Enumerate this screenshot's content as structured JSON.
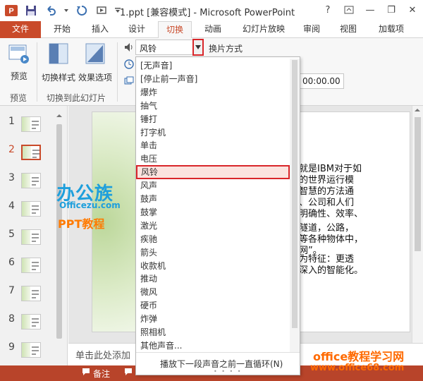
{
  "window": {
    "title": "1.ppt [兼容模式] - Microsoft PowerPoint",
    "controls": [
      "?",
      "—",
      "❐",
      "✕"
    ]
  },
  "tabs": [
    {
      "label": "文件",
      "type": "file"
    },
    {
      "label": "开始"
    },
    {
      "label": "插入"
    },
    {
      "label": "设计"
    },
    {
      "label": "切换",
      "active": true
    },
    {
      "label": "动画"
    },
    {
      "label": "幻灯片放映"
    },
    {
      "label": "审阅"
    },
    {
      "label": "视图"
    },
    {
      "label": "加载项"
    }
  ],
  "ribbon": {
    "preview_label": "预览",
    "transition_style_label": "切换样式",
    "effect_options_label": "效果选项",
    "group_preview": "预览",
    "group_transition_to_slide": "切换到此幻灯片",
    "sound_value": "风铃",
    "switch_mode_label": "换片方式",
    "duration_value": "00:00.00"
  },
  "dropdown": {
    "items": [
      "[无声音]",
      "[停止前一声音]",
      "爆炸",
      "抽气",
      "锤打",
      "打字机",
      "单击",
      "电压",
      "风铃",
      "风声",
      "鼓声",
      "鼓掌",
      "激光",
      "疾驰",
      "箭头",
      "收款机",
      "推动",
      "微风",
      "硬币",
      "炸弹",
      "照相机",
      "其他声音..."
    ],
    "highlighted_index": 8,
    "footer_loop_label": "播放下一段声音之前一直循环(N)"
  },
  "thumbnails": {
    "numbers": [
      "1",
      "2",
      "3",
      "4",
      "5",
      "6",
      "7",
      "8",
      "9"
    ],
    "selected_index": 1
  },
  "slide": {
    "text_lines": [
      "就是IBM对于如",
      "的世界运行模",
      "智慧的方法通",
      "、公司和人们",
      "明确性、效率、",
      "隧道，公路，",
      "等各种物体中，",
      "网”。",
      "为特征：更透",
      "深入的智能化。"
    ]
  },
  "notes": {
    "placeholder": "单击此处添加"
  },
  "status": {
    "notes_label": "备注"
  },
  "watermarks": {
    "logo_text": "办公族",
    "logo_sub": "Officezu.com",
    "ppt_text": "PPT教程",
    "site_text": "office教程学习网",
    "url_text": "www.office68.com"
  },
  "colors": {
    "accent": "#c94a2a",
    "highlight_border": "#d9262a",
    "status_bar": "#b8442a"
  }
}
